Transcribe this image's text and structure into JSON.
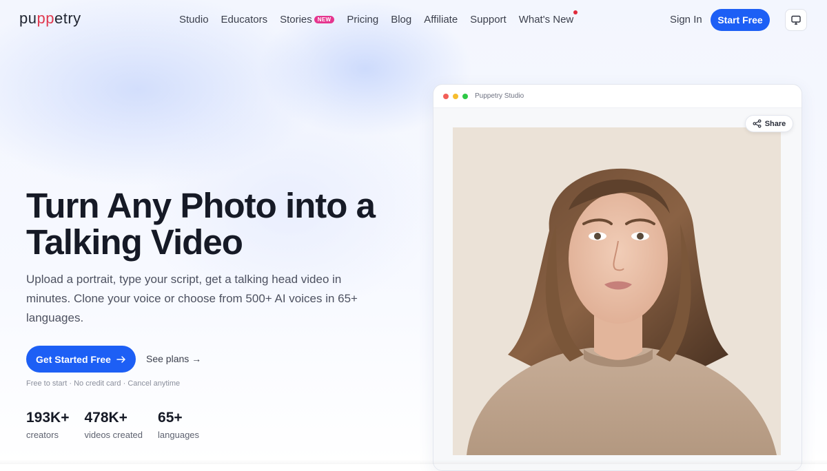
{
  "brand": {
    "logo_prefix": "pu",
    "logo_highlight": "pp",
    "logo_suffix": "etry",
    "accent": "#1d5ff5",
    "logo_highlight_color": "#e0384f"
  },
  "nav": {
    "links": [
      {
        "label": "Studio"
      },
      {
        "label": "Educators"
      },
      {
        "label": "Stories",
        "badge": "NEW"
      },
      {
        "label": "Pricing"
      },
      {
        "label": "Blog"
      },
      {
        "label": "Affiliate"
      },
      {
        "label": "Support"
      },
      {
        "label": "What's New"
      }
    ],
    "sign_in": "Sign In",
    "start_free": "Start Free",
    "monitor_icon": "monitor-icon",
    "badge_color": "#e5358f",
    "notification_dot_color": "#e02a3c"
  },
  "hero": {
    "title": "Turn Any Photo into a Talking Video",
    "subtitle": "Upload a portrait, type your script, get a talking head video in minutes. Clone your voice or choose from 500+ AI voices in 65+ languages.",
    "cta_primary": "Get Started Free",
    "cta_secondary": "See plans →",
    "fine_print": "Free to start · No credit card · Cancel anytime"
  },
  "stats": [
    {
      "value": "193K+",
      "label": "creators"
    },
    {
      "value": "478K+",
      "label": "videos created"
    },
    {
      "value": "65+",
      "label": "languages"
    }
  ],
  "studio": {
    "window_title": "Puppetry Studio",
    "share_label": "Share",
    "share_icon": "share-icon",
    "window_dot_colors": [
      "#f25f58",
      "#f6bd2f",
      "#2ec946"
    ]
  }
}
